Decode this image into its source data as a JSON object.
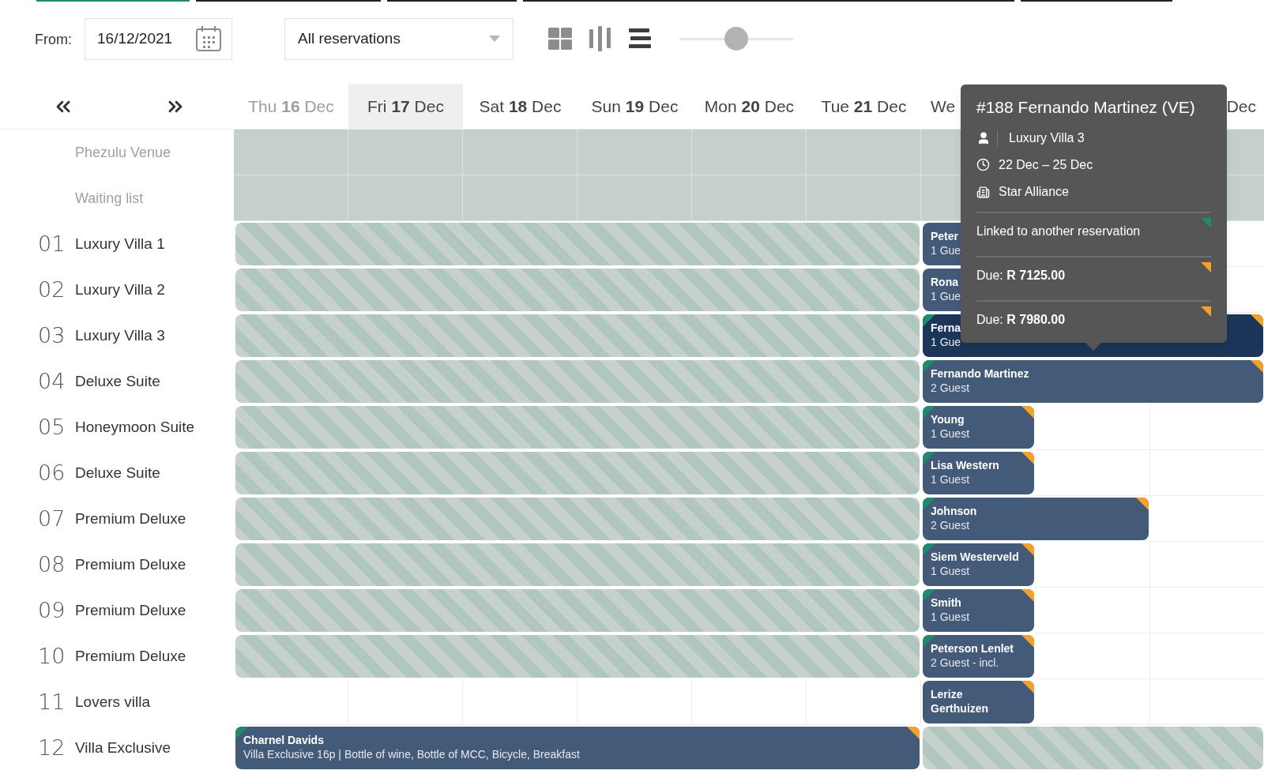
{
  "toolbar": {
    "from_label": "From:",
    "date": "16/12/2021",
    "filter": "All reservations",
    "views": [
      {
        "kind": "grid",
        "selected": false
      },
      {
        "kind": "columns",
        "selected": false
      },
      {
        "kind": "list",
        "selected": true
      }
    ],
    "zoom": {
      "level": 0.5
    }
  },
  "days": [
    {
      "kind": "full",
      "weekday": "Thu",
      "day": "16",
      "month": "Dec",
      "past": true,
      "selected": false
    },
    {
      "kind": "full",
      "weekday": "Fri",
      "day": "17",
      "month": "Dec",
      "past": false,
      "selected": true
    },
    {
      "kind": "full",
      "weekday": "Sat",
      "day": "18",
      "month": "Dec",
      "past": false,
      "selected": false
    },
    {
      "kind": "full",
      "weekday": "Sun",
      "day": "19",
      "month": "Dec",
      "past": false,
      "selected": false
    },
    {
      "kind": "full",
      "weekday": "Mon",
      "day": "20",
      "month": "Dec",
      "past": false,
      "selected": false
    },
    {
      "kind": "full",
      "weekday": "Tue",
      "day": "21",
      "month": "Dec",
      "past": false,
      "selected": false
    },
    {
      "kind": "partial",
      "text": "We"
    },
    {
      "kind": "partial",
      "text": "Dec"
    }
  ],
  "rows": [
    {
      "kind": "group",
      "name": "Phezulu Venue",
      "cells": [
        {
          "kind": "closed"
        },
        {
          "kind": "closed"
        },
        {
          "kind": "closed"
        },
        {
          "kind": "closed"
        },
        {
          "kind": "closed"
        },
        {
          "kind": "closed"
        },
        {
          "kind": "closed"
        },
        {
          "kind": "cont"
        },
        {
          "kind": "closed"
        }
      ]
    },
    {
      "kind": "group",
      "name": "Waiting list",
      "cells": [
        {
          "kind": "closed"
        },
        {
          "kind": "closed"
        },
        {
          "kind": "closed"
        },
        {
          "kind": "closed"
        },
        {
          "kind": "closed"
        },
        {
          "kind": "closed"
        },
        {
          "kind": "closed"
        },
        {
          "kind": "cont"
        },
        {
          "kind": "closed"
        }
      ]
    },
    {
      "kind": "room",
      "number": "01",
      "name": "Luxury Villa 1",
      "cells": [
        {
          "kind": "blocked"
        },
        {
          "kind": "cont"
        },
        {
          "kind": "cont"
        },
        {
          "kind": "cont"
        },
        {
          "kind": "cont"
        },
        {
          "kind": "cont"
        },
        {
          "kind": "booking",
          "guest": "Peter",
          "detail": "1 Gue",
          "selected": false
        },
        {
          "kind": "cont"
        },
        {
          "kind": "empty"
        }
      ]
    },
    {
      "kind": "room",
      "number": "02",
      "name": "Luxury Villa 2",
      "cells": [
        {
          "kind": "blocked"
        },
        {
          "kind": "cont"
        },
        {
          "kind": "cont"
        },
        {
          "kind": "cont"
        },
        {
          "kind": "cont"
        },
        {
          "kind": "cont"
        },
        {
          "kind": "booking",
          "guest": "Rona",
          "detail": "1 Gue",
          "selected": false
        },
        {
          "kind": "cont"
        },
        {
          "kind": "empty"
        }
      ]
    },
    {
      "kind": "room",
      "number": "03",
      "name": "Luxury Villa 3",
      "cells": [
        {
          "kind": "blocked"
        },
        {
          "kind": "cont"
        },
        {
          "kind": "cont"
        },
        {
          "kind": "cont"
        },
        {
          "kind": "cont"
        },
        {
          "kind": "cont"
        },
        {
          "kind": "booking",
          "guest": "Ferna",
          "detail": "1 Gue",
          "selected": true,
          "left_flag": true,
          "right_flag": true
        },
        {
          "kind": "cont"
        },
        {
          "kind": "cont"
        }
      ]
    },
    {
      "kind": "room",
      "number": "04",
      "name": "Deluxe Suite",
      "cells": [
        {
          "kind": "blocked"
        },
        {
          "kind": "cont"
        },
        {
          "kind": "cont"
        },
        {
          "kind": "cont"
        },
        {
          "kind": "cont"
        },
        {
          "kind": "cont"
        },
        {
          "kind": "booking",
          "guest": "Fernando Martinez",
          "detail": "2 Guest",
          "selected": false,
          "left_flag": true,
          "right_flag": true
        },
        {
          "kind": "cont"
        },
        {
          "kind": "cont"
        }
      ]
    },
    {
      "kind": "room",
      "number": "05",
      "name": "Honeymoon Suite",
      "cells": [
        {
          "kind": "blocked"
        },
        {
          "kind": "cont"
        },
        {
          "kind": "cont"
        },
        {
          "kind": "cont"
        },
        {
          "kind": "cont"
        },
        {
          "kind": "cont"
        },
        {
          "kind": "booking",
          "guest": "Young",
          "detail": "1 Guest",
          "selected": false,
          "left_flag": true,
          "right_flag": true
        },
        {
          "kind": "empty"
        },
        {
          "kind": "empty"
        }
      ]
    },
    {
      "kind": "room",
      "number": "06",
      "name": "Deluxe Suite",
      "cells": [
        {
          "kind": "blocked"
        },
        {
          "kind": "cont"
        },
        {
          "kind": "cont"
        },
        {
          "kind": "cont"
        },
        {
          "kind": "cont"
        },
        {
          "kind": "cont"
        },
        {
          "kind": "booking",
          "guest": "Lisa Western",
          "detail": "1 Guest",
          "selected": false,
          "left_flag": true,
          "right_flag": true
        },
        {
          "kind": "empty"
        },
        {
          "kind": "empty"
        }
      ]
    },
    {
      "kind": "room",
      "number": "07",
      "name": "Premium Deluxe",
      "cells": [
        {
          "kind": "blocked"
        },
        {
          "kind": "cont"
        },
        {
          "kind": "cont"
        },
        {
          "kind": "cont"
        },
        {
          "kind": "cont"
        },
        {
          "kind": "cont"
        },
        {
          "kind": "booking",
          "guest": "Johnson",
          "detail": "2 Guest",
          "selected": false,
          "left_flag": true,
          "right_flag": true
        },
        {
          "kind": "cont"
        },
        {
          "kind": "empty"
        }
      ]
    },
    {
      "kind": "room",
      "number": "08",
      "name": "Premium Deluxe",
      "cells": [
        {
          "kind": "blocked"
        },
        {
          "kind": "cont"
        },
        {
          "kind": "cont"
        },
        {
          "kind": "cont"
        },
        {
          "kind": "cont"
        },
        {
          "kind": "cont"
        },
        {
          "kind": "booking",
          "guest": "Siem Westerveld",
          "detail": "1 Guest",
          "selected": false,
          "left_flag": true,
          "right_flag": true
        },
        {
          "kind": "empty"
        },
        {
          "kind": "empty"
        }
      ]
    },
    {
      "kind": "room",
      "number": "09",
      "name": "Premium Deluxe",
      "cells": [
        {
          "kind": "blocked"
        },
        {
          "kind": "cont"
        },
        {
          "kind": "cont"
        },
        {
          "kind": "cont"
        },
        {
          "kind": "cont"
        },
        {
          "kind": "cont"
        },
        {
          "kind": "booking",
          "guest": "Smith",
          "detail": "1 Guest",
          "selected": false,
          "left_flag": true,
          "right_flag": true
        },
        {
          "kind": "empty"
        },
        {
          "kind": "empty"
        }
      ]
    },
    {
      "kind": "room",
      "number": "10",
      "name": "Premium Deluxe",
      "cells": [
        {
          "kind": "blocked"
        },
        {
          "kind": "cont"
        },
        {
          "kind": "cont"
        },
        {
          "kind": "cont"
        },
        {
          "kind": "cont"
        },
        {
          "kind": "cont"
        },
        {
          "kind": "booking",
          "guest": "Peterson Lenlet",
          "detail": "2 Guest - incl.",
          "selected": false,
          "left_flag": true,
          "right_flag": true
        },
        {
          "kind": "empty"
        },
        {
          "kind": "empty"
        }
      ]
    },
    {
      "kind": "room",
      "number": "11",
      "name": "Lovers villa",
      "cells": [
        {
          "kind": "empty"
        },
        {
          "kind": "empty"
        },
        {
          "kind": "empty"
        },
        {
          "kind": "empty"
        },
        {
          "kind": "empty"
        },
        {
          "kind": "empty"
        },
        {
          "kind": "booking",
          "guest": "Lerize Gerthuizen",
          "selected": false,
          "left_flag": false,
          "right_flag": true
        },
        {
          "kind": "empty"
        },
        {
          "kind": "empty"
        }
      ]
    },
    {
      "kind": "room",
      "number": "12",
      "name": "Villa Exclusive",
      "cells": [
        {
          "kind": "booking",
          "guest": "Charnel Davids",
          "detail": "Villa Exclusive 16p | Bottle of wine, Bottle of MCC, Bicycle, Breakfast",
          "selected": false,
          "left_flag": true,
          "right_flag": true
        },
        {
          "kind": "cont"
        },
        {
          "kind": "cont"
        },
        {
          "kind": "cont"
        },
        {
          "kind": "cont"
        },
        {
          "kind": "cont"
        },
        {
          "kind": "blocked"
        },
        {
          "kind": "cont"
        },
        {
          "kind": "cont"
        }
      ]
    }
  ],
  "tooltip": {
    "title": "#188 Fernando Martinez (VE)",
    "room": "Luxury Villa 3",
    "dates": "22 Dec – 25 Dec",
    "company": "Star Alliance",
    "items": [
      {
        "text": "Linked to another reservation",
        "color": "#1f8a6e"
      },
      {
        "text": "Due: **R 7125.00**",
        "color": "#f5a02a"
      },
      {
        "text": "Due: **R 7980.00**",
        "color": "#f5a02a"
      }
    ]
  }
}
